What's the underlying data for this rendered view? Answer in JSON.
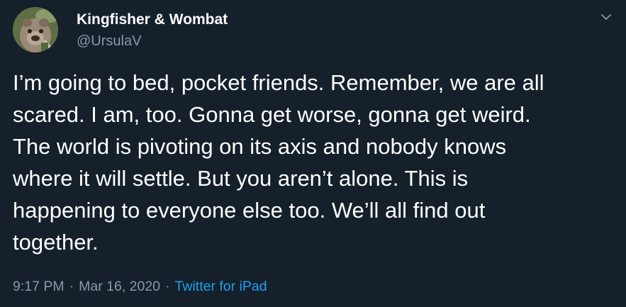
{
  "tweet": {
    "author_name": "Kingfisher & Wombat",
    "author_handle": "@UrsulaV",
    "text_lines": [
      "I’m going to bed, pocket friends. Remember, we are all",
      "scared. I am, too. Gonna get worse, gonna get weird.",
      "The world is pivoting on its axis and nobody knows",
      "where it will settle. But you aren’t alone. This is",
      "happening to everyone else too. We’ll all find out",
      "together."
    ],
    "time": "9:17 PM",
    "separator": "·",
    "date": "Mar 16, 2020",
    "source": "Twitter for iPad"
  },
  "icons": {
    "more": "chevron-down-icon",
    "avatar": "wombat-avatar"
  },
  "colors": {
    "background": "#15202b",
    "text_primary": "#ffffff",
    "text_secondary": "#8899a6",
    "link": "#1da1f2"
  }
}
